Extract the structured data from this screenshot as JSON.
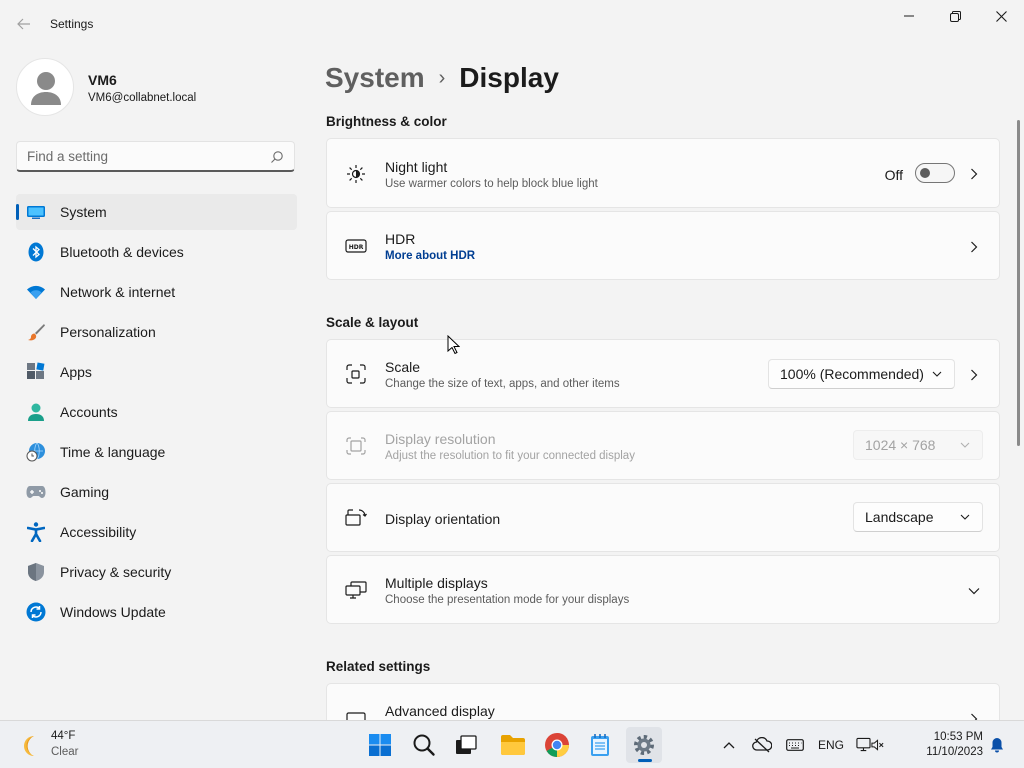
{
  "window": {
    "title": "Settings"
  },
  "profile": {
    "name": "VM6",
    "email": "VM6@collabnet.local"
  },
  "search": {
    "placeholder": "Find a setting",
    "value": ""
  },
  "sidebar": {
    "items": [
      {
        "label": "System",
        "icon": "system-icon",
        "selected": true
      },
      {
        "label": "Bluetooth & devices",
        "icon": "bluetooth-icon"
      },
      {
        "label": "Network & internet",
        "icon": "wifi-icon"
      },
      {
        "label": "Personalization",
        "icon": "paintbrush-icon"
      },
      {
        "label": "Apps",
        "icon": "apps-icon"
      },
      {
        "label": "Accounts",
        "icon": "accounts-icon"
      },
      {
        "label": "Time & language",
        "icon": "time-language-icon"
      },
      {
        "label": "Gaming",
        "icon": "gamepad-icon"
      },
      {
        "label": "Accessibility",
        "icon": "accessibility-icon"
      },
      {
        "label": "Privacy & security",
        "icon": "shield-icon"
      },
      {
        "label": "Windows Update",
        "icon": "windows-update-icon"
      }
    ]
  },
  "breadcrumb": {
    "parent": "System",
    "separator": "›",
    "current": "Display"
  },
  "sections": {
    "brightness": "Brightness & color",
    "scale_layout": "Scale & layout",
    "related": "Related settings"
  },
  "cards": {
    "night_light": {
      "title": "Night light",
      "subtitle": "Use warmer colors to help block blue light",
      "toggle_label": "Off",
      "toggle_on": false
    },
    "hdr": {
      "title": "HDR",
      "link": "More about HDR"
    },
    "scale": {
      "title": "Scale",
      "subtitle": "Change the size of text, apps, and other items",
      "value": "100% (Recommended)"
    },
    "resolution": {
      "title": "Display resolution",
      "subtitle": "Adjust the resolution to fit your connected display",
      "value": "1024 × 768",
      "disabled": true
    },
    "orientation": {
      "title": "Display orientation",
      "value": "Landscape"
    },
    "multiple": {
      "title": "Multiple displays",
      "subtitle": "Choose the presentation mode for your displays"
    },
    "advanced": {
      "title": "Advanced display"
    }
  },
  "taskbar": {
    "weather": {
      "temp": "44°F",
      "condition": "Clear"
    },
    "apps": [
      "start-icon",
      "search-icon",
      "task-view-icon",
      "file-explorer-icon",
      "chrome-icon",
      "notepad-icon",
      "settings-icon"
    ],
    "language": "ENG",
    "time": "10:53 PM",
    "date": "11/10/2023"
  },
  "colors": {
    "accent": "#005fb8",
    "link": "#003e92",
    "background": "#f3f3f3",
    "card": "#fbfbfb"
  }
}
